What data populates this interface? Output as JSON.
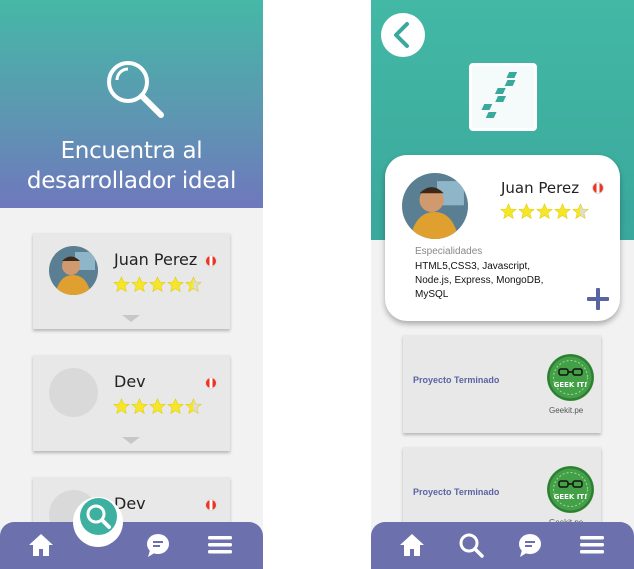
{
  "screen_a": {
    "title_line1": "Encuentra al",
    "title_line2": "desarrollador ideal",
    "cards": [
      {
        "name": "Juan Perez",
        "rating": 4.5,
        "has_photo": true
      },
      {
        "name": "Dev",
        "rating": 4.5,
        "has_photo": false
      },
      {
        "name": "Dev",
        "rating": 4.5,
        "has_photo": false
      }
    ],
    "nav": [
      "home-icon",
      "search-icon",
      "chat-icon",
      "menu-icon"
    ]
  },
  "screen_b": {
    "profile": {
      "name": "Juan Perez",
      "rating": 4.5,
      "specialties_label": "Especialidades",
      "specialties": "HTML5,CSS3, Javascript, Node.js, Express, MongoDB, MySQL"
    },
    "projects": [
      {
        "label": "Proyecto Terminado",
        "company": "Geekit.pe",
        "logo_text": "GEEK IT!"
      },
      {
        "label": "Proyecto Terminado",
        "company": "Geekit.pe",
        "logo_text": "GEEK IT!"
      }
    ],
    "nav": [
      "home-icon",
      "search-icon",
      "chat-icon",
      "menu-icon"
    ]
  },
  "colors": {
    "teal": "#45b8a6",
    "purple": "#6c71ae",
    "star": "#f6e62a",
    "flag_red": "#e32222"
  }
}
